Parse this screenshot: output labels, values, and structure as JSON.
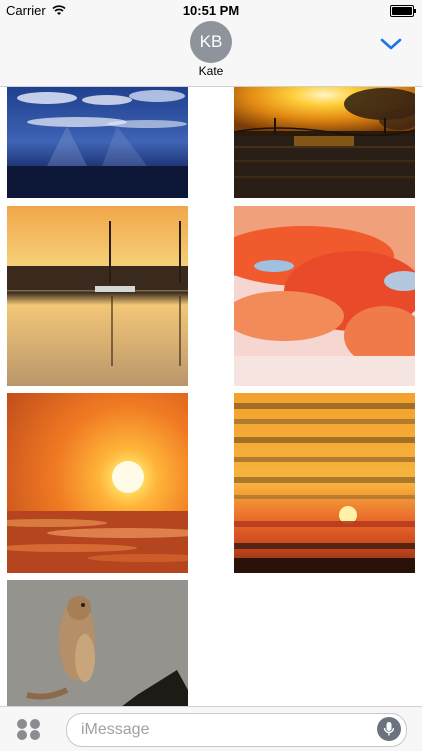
{
  "status_bar": {
    "carrier": "Carrier",
    "time": "10:51 PM"
  },
  "header": {
    "avatar_initials": "KB",
    "contact_name": "Kate"
  },
  "input": {
    "placeholder": "iMessage"
  },
  "icons": {
    "wifi": "wifi-icon",
    "battery": "battery-icon",
    "chevron": "chevron-down-icon",
    "apps": "app-drawer-icon",
    "mic": "microphone-icon"
  },
  "colors": {
    "accent": "#1a73e8",
    "header_bg": "#f7f7f7",
    "avatar_bg": "#8f949c"
  }
}
